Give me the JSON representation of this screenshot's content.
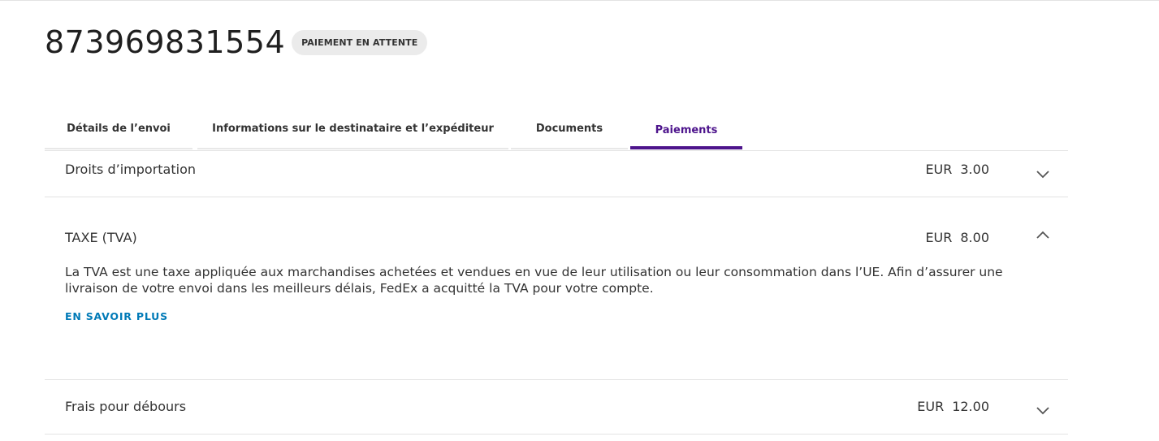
{
  "header": {
    "tracking_number": "873969831554",
    "status_badge": "PAIEMENT EN ATTENTE"
  },
  "tabs": [
    {
      "label": "Détails de l’envoi",
      "active": false
    },
    {
      "label": "Informations sur le destinataire et l’expéditeur",
      "active": false
    },
    {
      "label": "Documents",
      "active": false
    },
    {
      "label": "Paiements",
      "active": true
    }
  ],
  "payments": [
    {
      "title": "Droits d’importation",
      "currency": "EUR",
      "amount": "3.00",
      "expanded": false
    },
    {
      "title": "TAXE (TVA)",
      "currency": "EUR",
      "amount": "8.00",
      "expanded": true,
      "description": "La TVA est une taxe appliquée aux marchandises achetées et vendues en vue de leur utilisation ou leur consommation dans l’UE. Afin d’assurer une livraison de votre envoi dans les meilleurs délais, FedEx a acquitté la TVA pour votre compte.",
      "link_label": "EN SAVOIR PLUS"
    },
    {
      "title": "Frais pour débours",
      "currency": "EUR",
      "amount": "12.00",
      "expanded": false
    }
  ],
  "colors": {
    "accent": "#4d148c",
    "link": "#007ab7",
    "badge_bg": "#ebebeb",
    "divider": "#e3e3e3"
  }
}
